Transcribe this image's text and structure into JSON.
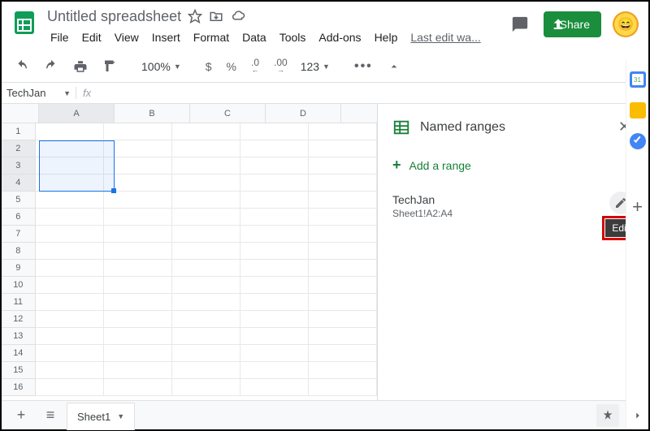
{
  "header": {
    "doc_title": "Untitled spreadsheet",
    "share_label": "Share",
    "last_edit": "Last edit wa...",
    "menus": [
      "File",
      "Edit",
      "View",
      "Insert",
      "Format",
      "Data",
      "Tools",
      "Add-ons",
      "Help"
    ]
  },
  "toolbar": {
    "zoom": "100%",
    "currency": "$",
    "percent": "%",
    "dec_dec": ".0",
    "inc_dec": ".00",
    "num_format": "123",
    "more": "•••"
  },
  "formula": {
    "name_box": "TechJan",
    "fx": "fx"
  },
  "grid": {
    "columns": [
      "A",
      "B",
      "C",
      "D"
    ],
    "rows": [
      "1",
      "2",
      "3",
      "4",
      "5",
      "6",
      "7",
      "8",
      "9",
      "10",
      "11",
      "12",
      "13",
      "14",
      "15",
      "16"
    ],
    "selected_col": "A",
    "selected_rows": [
      "2",
      "3",
      "4"
    ]
  },
  "side_panel": {
    "title": "Named ranges",
    "add_label": "Add a range",
    "items": [
      {
        "name": "TechJan",
        "ref": "Sheet1!A2:A4"
      }
    ],
    "edit_tooltip": "Edit"
  },
  "sheets": {
    "active": "Sheet1"
  }
}
